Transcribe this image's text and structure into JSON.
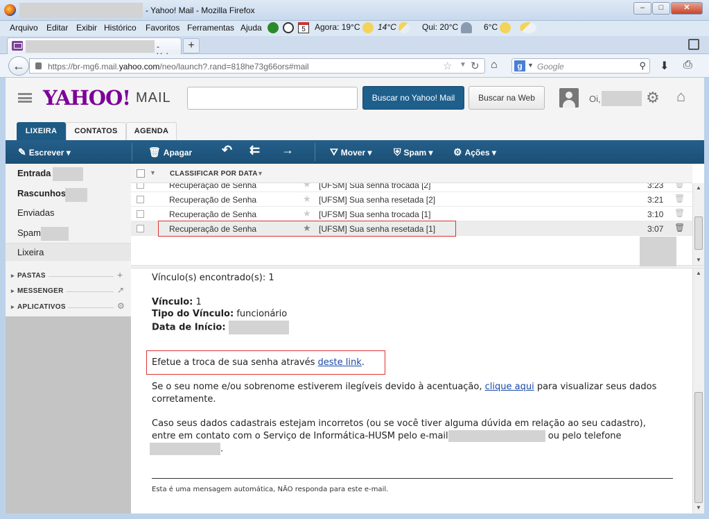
{
  "window": {
    "title": "- Yahoo! Mail - Mozilla Firefox",
    "minimize": "–",
    "maximize": "□",
    "close": "✕"
  },
  "menubar": {
    "items": [
      "Arquivo",
      "Editar",
      "Exibir",
      "Histórico",
      "Favoritos",
      "Ferramentas",
      "Ajuda"
    ],
    "weather": [
      {
        "label": "Agora: 19°C",
        "icon": "sun-icon"
      },
      {
        "label": "14°C",
        "icon": "partly-cloudy-icon"
      },
      {
        "label": "Qui: 20°C",
        "icon": "rain-cloud-icon"
      },
      {
        "label": "6°C",
        "icon": "sun-icon"
      }
    ],
    "calendar_day": "5"
  },
  "tabs": {
    "active_label": "- Yaho...",
    "close": "✕",
    "new_tab": "+"
  },
  "navbar": {
    "url_prefix": "https://br-mg6.mail.",
    "url_domain": "yahoo.com",
    "url_suffix": "/neo/launch?.rand=818he73g66ors#mail",
    "search_placeholder": "Google"
  },
  "yahoo": {
    "logo": "YAHOO!",
    "logo_suffix": "MAIL",
    "search_button": "Buscar no Yahoo! Mail",
    "web_button": "Buscar na Web",
    "greeting": "Oi,",
    "tabs": [
      "LIXEIRA",
      "CONTATOS",
      "AGENDA"
    ],
    "toolbar": {
      "compose": "Escrever",
      "delete": "Apagar",
      "move": "Mover",
      "spam": "Spam",
      "actions": "Ações"
    },
    "folders": {
      "inbox": "Entrada",
      "drafts": "Rascunhos",
      "sent": "Enviadas",
      "spam": "Spam",
      "trash": "Lixeira"
    },
    "sections": [
      "PASTAS",
      "MESSENGER",
      "APLICATIVOS"
    ],
    "list_header": "CLASSIFICAR POR DATA",
    "messages": [
      {
        "from": "Recuperação de Senha",
        "subject": "[UFSM] Sua senha trocada [2]",
        "time": "3:23"
      },
      {
        "from": "Recuperação de Senha",
        "subject": "[UFSM] Sua senha resetada [2]",
        "time": "3:21"
      },
      {
        "from": "Recuperação de Senha",
        "subject": "[UFSM] Sua senha trocada [1]",
        "time": "3:10"
      },
      {
        "from": "Recuperação de Senha",
        "subject": "[UFSM] Sua senha resetada [1]",
        "time": "3:07"
      }
    ],
    "body": {
      "found": "Vínculo(s) encontrado(s): 1",
      "vinculo_label": "Vínculo:",
      "vinculo_value": "1",
      "tipo_label": "Tipo do Vínculo:",
      "tipo_value": "funcionário",
      "data_label": "Data de Início:",
      "change_text": "Efetue a troca de sua senha através ",
      "change_link": "deste link",
      "change_end": ".",
      "names_text_1": "Se o seu nome e/ou sobrenome estiverem ilegíveis devido à acentuação, ",
      "names_link": "clique aqui",
      "names_text_2": " para visualizar seus dados",
      "names_text_3": "corretamente.",
      "contact_1": "Caso seus dados cadastrais estejam incorretos (ou se você tiver alguma dúvida em relação ao seu cadastro),",
      "contact_2": "entre em contato com o Serviço de Informática-HUSM pelo e-mail",
      "contact_3": " ou pelo telefone",
      "contact_end": ".",
      "footer": "Esta é uma mensagem automática, NÃO responda para este e-mail."
    }
  }
}
